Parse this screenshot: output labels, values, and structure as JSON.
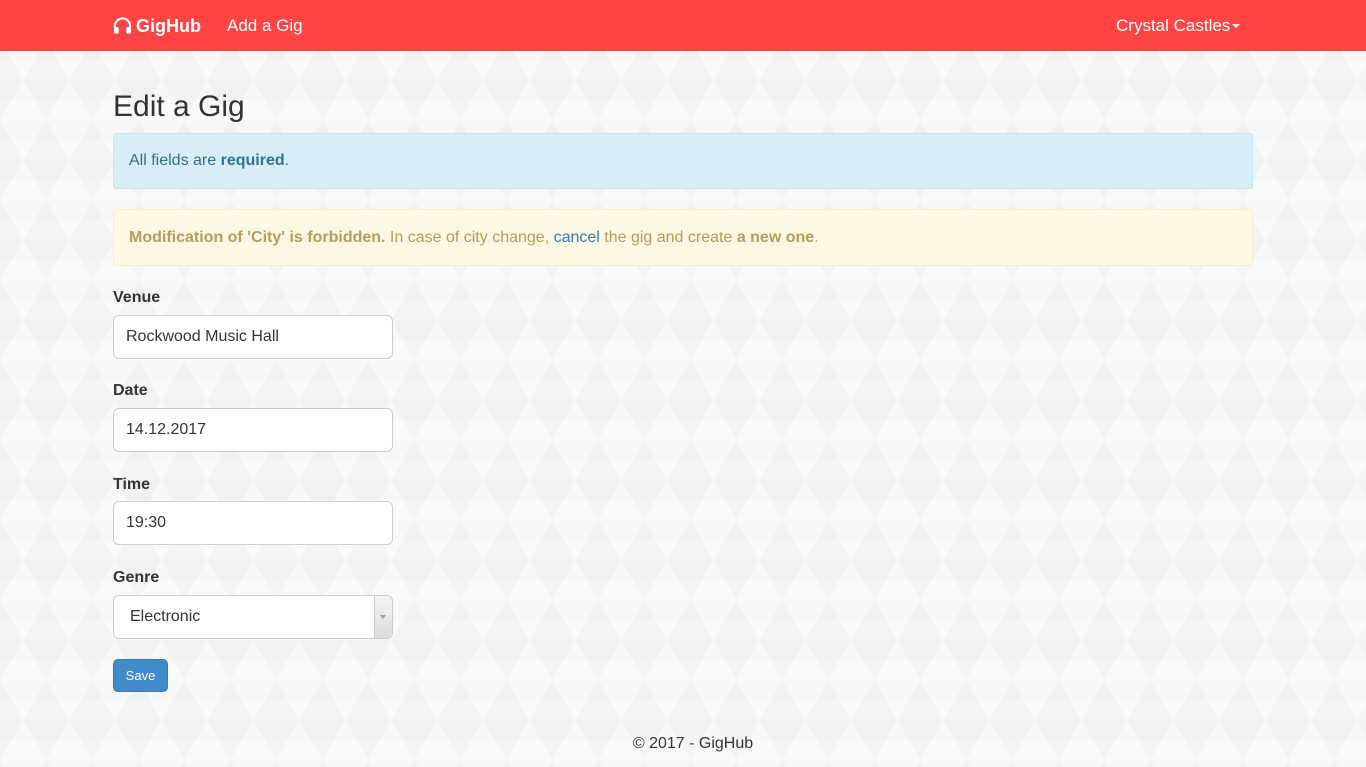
{
  "navbar": {
    "brand": "GigHub",
    "brand_icon": "headphones-icon",
    "add_gig": "Add a Gig",
    "user_name": "Crystal Castles",
    "color": "#ff4444"
  },
  "page": {
    "title": "Edit a Gig"
  },
  "alerts": {
    "info_prefix": "All fields are ",
    "info_bold": "required",
    "info_suffix": ".",
    "warning_bold": "Modification of 'City' is forbidden.",
    "warning_text1": " In case of city change, ",
    "warning_link": "cancel",
    "warning_text2": " the gig and create ",
    "warning_bold2": "a new one",
    "warning_suffix": "."
  },
  "form": {
    "venue_label": "Venue",
    "venue_value": "Rockwood Music Hall",
    "date_label": "Date",
    "date_value": "14.12.2017",
    "time_label": "Time",
    "time_value": "19:30",
    "genre_label": "Genre",
    "genre_value": "Electronic",
    "save_label": "Save"
  },
  "footer": {
    "text": "© 2017 - GigHub"
  }
}
